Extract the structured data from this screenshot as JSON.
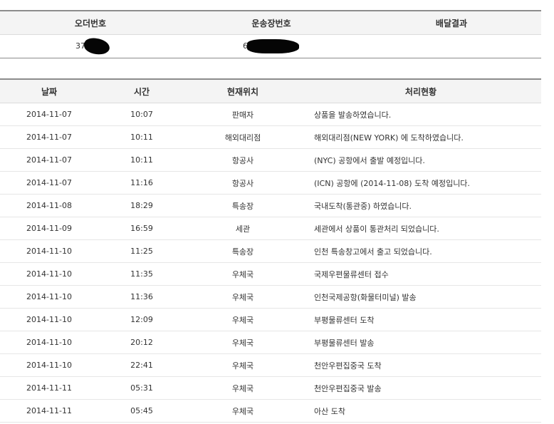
{
  "summary": {
    "headers": [
      "오더번호",
      "운송장번호",
      "배달결과"
    ],
    "order_no_visible": "37",
    "waybill_no_visible": "6",
    "delivery_result": ""
  },
  "tracking": {
    "headers": [
      "날짜",
      "시간",
      "현재위치",
      "처리현황"
    ],
    "rows": [
      {
        "date": "2014-11-07",
        "time": "10:07",
        "location": "판매자",
        "status": "상품을 발송하였습니다."
      },
      {
        "date": "2014-11-07",
        "time": "10:11",
        "location": "해외대리점",
        "status": "해외대리점(NEW YORK) 에 도착하였습니다."
      },
      {
        "date": "2014-11-07",
        "time": "10:11",
        "location": "항공사",
        "status": "(NYC) 공항에서 출발 예정입니다."
      },
      {
        "date": "2014-11-07",
        "time": "11:16",
        "location": "항공사",
        "status": "(ICN) 공항에 (2014-11-08) 도착 예정입니다."
      },
      {
        "date": "2014-11-08",
        "time": "18:29",
        "location": "특송장",
        "status": "국내도착(통관중) 하였습니다."
      },
      {
        "date": "2014-11-09",
        "time": "16:59",
        "location": "세관",
        "status": "세관에서 상품이 통관처리 되었습니다."
      },
      {
        "date": "2014-11-10",
        "time": "11:25",
        "location": "특송장",
        "status": "인천 특송창고에서 출고 되었습니다."
      },
      {
        "date": "2014-11-10",
        "time": "11:35",
        "location": "우체국",
        "status": "국제우편물류센터 접수"
      },
      {
        "date": "2014-11-10",
        "time": "11:36",
        "location": "우체국",
        "status": "인천국제공항(화물터미널) 발송"
      },
      {
        "date": "2014-11-10",
        "time": "12:09",
        "location": "우체국",
        "status": "부평물류센터 도착"
      },
      {
        "date": "2014-11-10",
        "time": "20:12",
        "location": "우체국",
        "status": "부평물류센터 발송"
      },
      {
        "date": "2014-11-10",
        "time": "22:41",
        "location": "우체국",
        "status": "천안우편집중국 도착"
      },
      {
        "date": "2014-11-11",
        "time": "05:31",
        "location": "우체국",
        "status": "천안우편집중국 발송"
      },
      {
        "date": "2014-11-11",
        "time": "05:45",
        "location": "우체국",
        "status": "아산 도착"
      }
    ]
  }
}
